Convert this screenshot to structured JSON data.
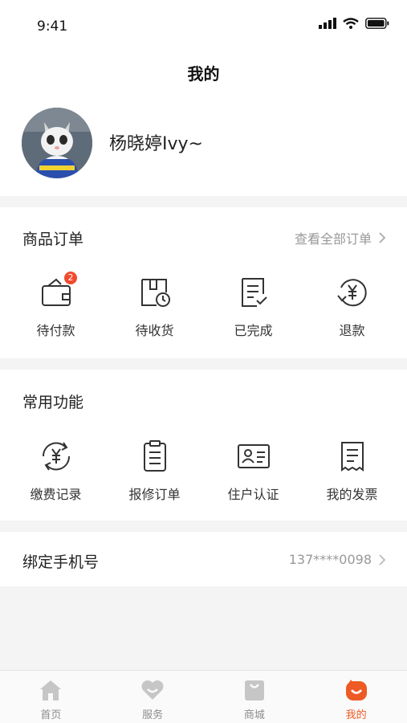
{
  "status_bar": {
    "time": "9:41"
  },
  "header": {
    "title": "我的"
  },
  "profile": {
    "username": "杨晓婷Ivy~"
  },
  "orders": {
    "title": "商品订单",
    "view_all": "查看全部订单",
    "items": [
      {
        "label": "待付款",
        "icon": "wallet-icon",
        "badge": "2"
      },
      {
        "label": "待收货",
        "icon": "package-clock-icon"
      },
      {
        "label": "已完成",
        "icon": "document-check-icon"
      },
      {
        "label": "退款",
        "icon": "refund-yen-icon"
      }
    ]
  },
  "functions": {
    "title": "常用功能",
    "items": [
      {
        "label": "缴费记录",
        "icon": "yen-refresh-icon"
      },
      {
        "label": "报修订单",
        "icon": "clipboard-list-icon"
      },
      {
        "label": "住户认证",
        "icon": "id-card-icon"
      },
      {
        "label": "我的发票",
        "icon": "invoice-icon"
      }
    ]
  },
  "phone": {
    "label": "绑定手机号",
    "value": "137****0098"
  },
  "tabbar": {
    "items": [
      {
        "label": "首页",
        "icon": "home-icon"
      },
      {
        "label": "服务",
        "icon": "heart-icon"
      },
      {
        "label": "商城",
        "icon": "shopping-bag-icon"
      },
      {
        "label": "我的",
        "icon": "profile-face-icon",
        "active": true
      }
    ]
  },
  "colors": {
    "accent": "#ee5a24",
    "badge": "#f04a2e",
    "background": "#f4f4f4"
  }
}
